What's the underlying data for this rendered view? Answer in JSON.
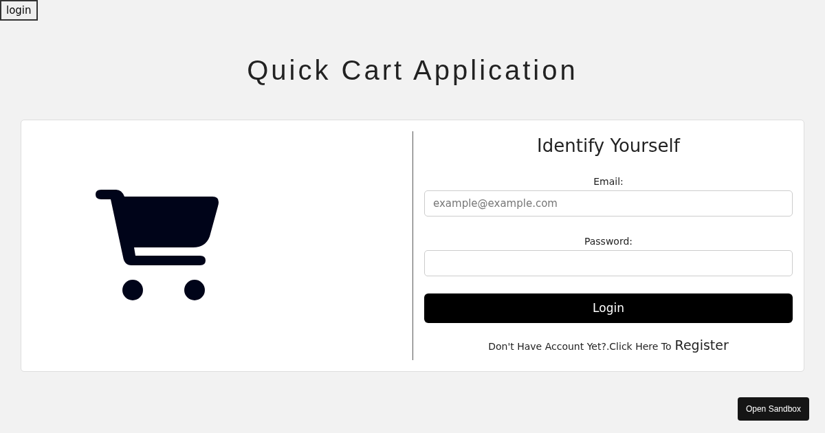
{
  "top_button": "login",
  "title": "Quick Cart Application",
  "form": {
    "heading": "Identify Yourself",
    "fields": [
      {
        "label": "Email:",
        "placeholder": "example@example.com"
      },
      {
        "label": "Password:"
      }
    ],
    "submit": "Login",
    "register_prompt": "Don't Have Account Yet?.Click Here To",
    "register_link": "Register"
  },
  "sandbox_button": "Open Sandbox"
}
